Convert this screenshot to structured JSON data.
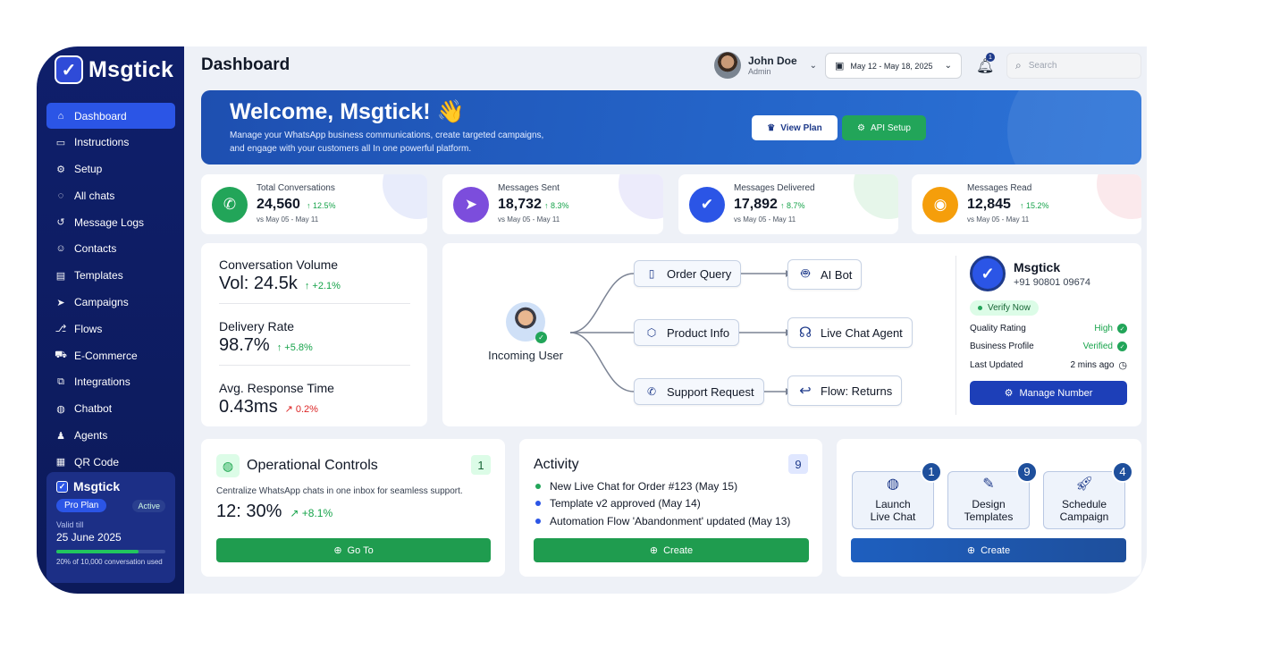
{
  "brand": {
    "name": "Msgtick"
  },
  "page_title": "Dashboard",
  "nav": [
    {
      "label": "Dashboard",
      "icon": "home-icon",
      "active": true
    },
    {
      "label": "Instructions",
      "icon": "message-square-icon"
    },
    {
      "label": "Setup",
      "icon": "gear-icon"
    },
    {
      "label": "All chats",
      "icon": "chat-bubbles-icon"
    },
    {
      "label": "Message Logs",
      "icon": "history-icon"
    },
    {
      "label": "Contacts",
      "icon": "user-icon"
    },
    {
      "label": "Templates",
      "icon": "template-icon"
    },
    {
      "label": "Campaigns",
      "icon": "send-icon"
    },
    {
      "label": "Flows",
      "icon": "flow-icon"
    },
    {
      "label": "E-Commerce",
      "icon": "cart-icon"
    },
    {
      "label": "Integrations",
      "icon": "integrations-icon"
    },
    {
      "label": "Chatbot",
      "icon": "chatbot-icon"
    },
    {
      "label": "Agents",
      "icon": "agent-icon"
    },
    {
      "label": "QR Code",
      "icon": "qr-icon"
    }
  ],
  "plan": {
    "name": "Msgtick",
    "tier": "Pro Plan",
    "status": "Active",
    "valid_label": "Valid till",
    "valid_date": "25 June 2025",
    "usage_fraction": 0.75,
    "usage_text": "20% of 10,000 conversation used"
  },
  "user": {
    "name": "John Doe",
    "role": "Admin"
  },
  "date_range": "May 12 - May 18, 2025",
  "notifications": {
    "count": "1"
  },
  "search": {
    "placeholder": "Search"
  },
  "hero": {
    "title": "Welcome, Msgtick! 👋",
    "subtitle": "Manage your WhatsApp business communications, create targeted campaigns, and engage with your customers all In one powerful platform.",
    "view_plan": "View Plan",
    "api_setup": "API Setup"
  },
  "stats": [
    {
      "label": "Total Conversations",
      "value": "24,560",
      "change": "12.5%",
      "compare": "vs May 05 - May 11",
      "icon": "whatsapp-icon",
      "color": "#22a559",
      "deco": "#e8ecfb"
    },
    {
      "label": "Messages Sent",
      "value": "18,732",
      "change": "8.3%",
      "compare": "vs May 05 - May 11",
      "icon": "paper-plane-icon",
      "color": "#7c4ddc",
      "deco": "#ecebfb"
    },
    {
      "label": "Messages Delivered",
      "value": "17,892",
      "change": "8.7%",
      "compare": "vs May 05 - May 11",
      "icon": "check-badge-icon",
      "color": "#2b55e6",
      "deco": "#e6f6ea"
    },
    {
      "label": "Messages Read",
      "value": "12,845",
      "change": "15.2%",
      "compare": "vs May 05 - May 11",
      "icon": "eye-icon",
      "color": "#f59e0b",
      "deco": "#fbe9ec"
    }
  ],
  "metrics": [
    {
      "label": "Conversation Volume",
      "value": "Vol: 24.5k",
      "change": "+2.1%",
      "trend": "up"
    },
    {
      "label": "Delivery Rate",
      "value": "98.7%",
      "change": "+5.8%",
      "trend": "up"
    },
    {
      "label": "Avg. Response Time",
      "value": "0.43ms",
      "change": "0.2%",
      "trend": "down"
    }
  ],
  "flow": {
    "source": "Incoming User",
    "routes": [
      {
        "intent": "Order Query",
        "target": "AI Bot"
      },
      {
        "intent": "Product Info",
        "target": "Live Chat Agent"
      },
      {
        "intent": "Support Request",
        "target": "Flow: Returns"
      }
    ]
  },
  "account": {
    "name": "Msgtick",
    "phone": "+91 90801 09674",
    "verify": "Verify Now",
    "rows": [
      {
        "label": "Quality Rating",
        "value": "High"
      },
      {
        "label": "Business Profile",
        "value": "Verified"
      },
      {
        "label": "Last Updated",
        "value": "2 mins ago"
      }
    ],
    "manage": "Manage Number"
  },
  "operational": {
    "title": "Operational Controls",
    "count": "1",
    "desc": "Centralize WhatsApp chats in one inbox for seamless support.",
    "value": "12: 30%",
    "change": "+8.1%",
    "button": "Go To"
  },
  "activity": {
    "title": "Activity",
    "count": "9",
    "items": [
      {
        "text": "New Live Chat for Order #123 (May 15)",
        "color": "#22a559"
      },
      {
        "text": "Template v2 approved (May 14)",
        "color": "#2b55e6"
      },
      {
        "text": "Automation Flow 'Abandonment' updated (May 13)",
        "color": "#2b55e6"
      }
    ],
    "button": "Create"
  },
  "quick_actions": {
    "items": [
      {
        "label_1": "Launch",
        "label_2": "Live Chat",
        "badge": "1",
        "icon": "chat-icon"
      },
      {
        "label_1": "Design",
        "label_2": "Templates",
        "badge": "9",
        "icon": "edit-icon"
      },
      {
        "label_1": "Schedule",
        "label_2": "Campaign",
        "badge": "4",
        "icon": "rocket-icon"
      }
    ],
    "button": "Create"
  }
}
